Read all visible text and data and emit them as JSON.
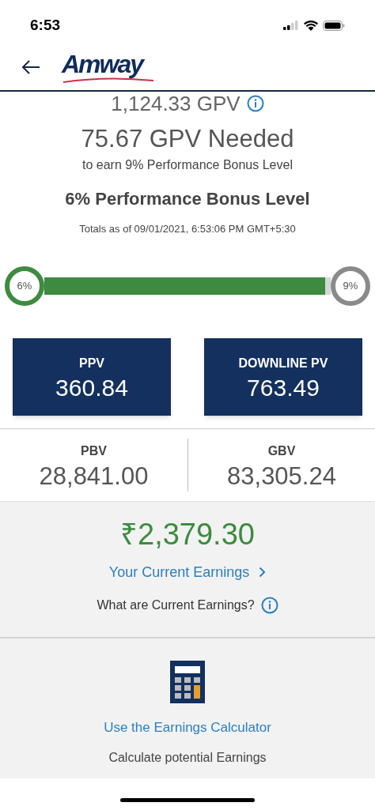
{
  "status_bar": {
    "time": "6:53"
  },
  "header": {
    "logo": "Amway"
  },
  "summary": {
    "gpv": "1,124.33 GPV",
    "needed": "75.67 GPV Needed",
    "needed_note": "to earn 9% Performance Bonus Level",
    "current_level": "6% Performance Bonus Level",
    "totals": "Totals as of 09/01/2021, 6:53:06 PM GMT+5:30"
  },
  "progress": {
    "start": "6%",
    "end": "9%",
    "level": 0.98
  },
  "cards": [
    {
      "label": "PPV",
      "value": "360.84"
    },
    {
      "label": "DOWNLINE PV",
      "value": "763.49"
    }
  ],
  "stats": [
    {
      "label": "PBV",
      "value": "28,841.00"
    },
    {
      "label": "GBV",
      "value": "83,305.24"
    }
  ],
  "earnings": {
    "amount": "₹2,379.30",
    "link": "Your Current Earnings",
    "question": "What are Current Earnings?"
  },
  "calculator": {
    "link": "Use the Earnings Calculator",
    "note": "Calculate potential Earnings"
  }
}
